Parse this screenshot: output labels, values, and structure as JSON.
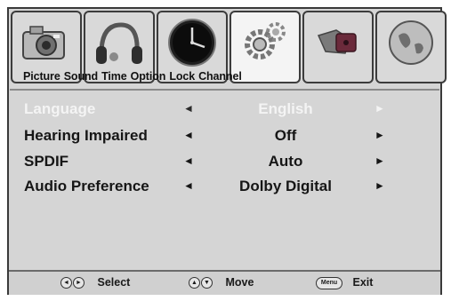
{
  "tabs": {
    "items": [
      {
        "name": "Picture",
        "icon": "camera-icon"
      },
      {
        "name": "Sound",
        "icon": "headphones-icon"
      },
      {
        "name": "Time",
        "icon": "clock-icon"
      },
      {
        "name": "Option",
        "icon": "gear-icon",
        "active": true
      },
      {
        "name": "Lock",
        "icon": "lock-icon"
      },
      {
        "name": "Channel",
        "icon": "globe-icon"
      }
    ]
  },
  "menu": {
    "rows": [
      {
        "label": "Language",
        "value": "English",
        "selected": true
      },
      {
        "label": "Hearing Impaired",
        "value": "Off"
      },
      {
        "label": "SPDIF",
        "value": "Auto"
      },
      {
        "label": "Audio Preference",
        "value": "Dolby Digital"
      }
    ]
  },
  "footer": {
    "select_label": "Select",
    "move_label": "Move",
    "menu_key": "Menu",
    "exit_label": "Exit"
  },
  "colors": {
    "background": "#d5d5d5",
    "selected_text": "#f4f4f4",
    "text": "#161616"
  }
}
